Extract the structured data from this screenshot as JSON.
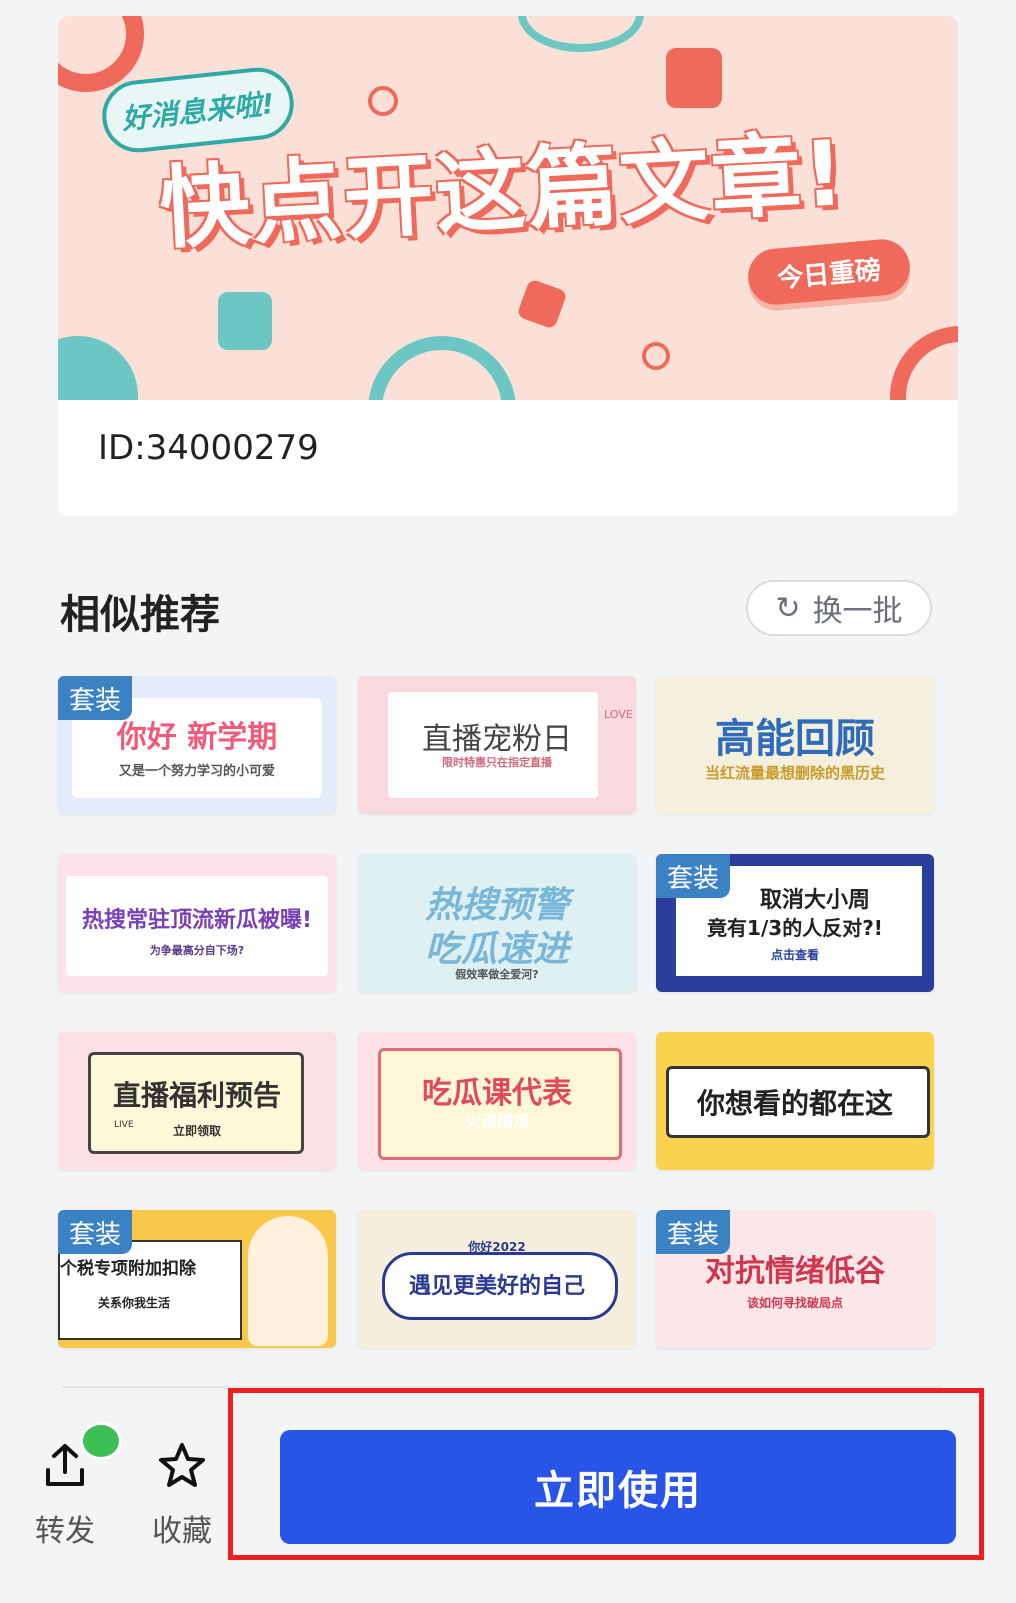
{
  "hero": {
    "bubble_text": "好消息来啦!",
    "title": "快点开这篇文章!",
    "pill_text": "今日重磅",
    "id_label": "ID:34000279"
  },
  "section": {
    "title": "相似推荐",
    "refresh_label": "换一批"
  },
  "badge_label": "套装",
  "tiles": [
    {
      "badge": true,
      "main": "你好 新学期",
      "sub": "又是一个努力学习的小可爱"
    },
    {
      "badge": false,
      "main": "直播宠粉日",
      "sub": "限时特惠只在指定直播",
      "extra": "LOVE"
    },
    {
      "badge": false,
      "main": "高能回顾",
      "sub": "当红流量最想删除的黑历史"
    },
    {
      "badge": false,
      "main": "热搜常驻顶流新瓜被曝!",
      "sub": "为争最高分自下场?"
    },
    {
      "badge": false,
      "main": "热搜预警",
      "main2": "吃瓜速进",
      "sub": "假效率做全爱河?"
    },
    {
      "badge": true,
      "main": "取消大小周",
      "main2": "竟有1/3的人反对?!",
      "sub": "点击查看"
    },
    {
      "badge": false,
      "main": "直播福利预告",
      "sub": "立即领取",
      "extra": "LIVE"
    },
    {
      "badge": false,
      "main": "吃瓜课代表",
      "sub": "火速围观"
    },
    {
      "badge": false,
      "main": "你想看的都在这"
    },
    {
      "badge": true,
      "main": "个税专项附加扣除",
      "sub": "关系你我生活"
    },
    {
      "badge": false,
      "main": "遇见更美好的自己",
      "sub": "你好2022"
    },
    {
      "badge": true,
      "main": "对抗情绪低谷",
      "sub": "该如何寻找破局点"
    }
  ],
  "bottom": {
    "share_label": "转发",
    "favorite_label": "收藏",
    "use_label": "立即使用"
  },
  "colors": {
    "primary": "#2855e8",
    "badge": "#3b82c4",
    "highlight": "#ee1f1f",
    "hero_bg": "#fbe0d7",
    "hero_accent": "#ef6a5a"
  }
}
